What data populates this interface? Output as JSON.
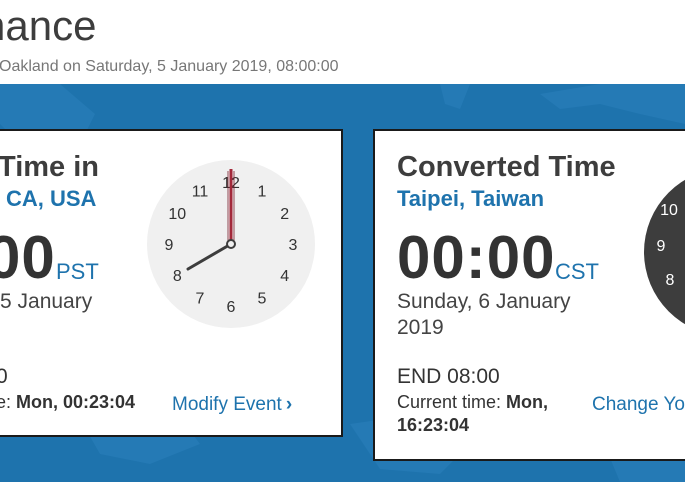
{
  "header": {
    "title": "nance",
    "subtitle": "Oakland on Saturday, 5 January 2019, 08:00:00"
  },
  "left_card": {
    "title": "Time in",
    "location": "CA, USA",
    "time": "00",
    "timezone": "PST",
    "date": "5 January",
    "end": "0",
    "current_label": "e:",
    "current_value": "Mon, 00:23:04",
    "action": "Modify Event",
    "clock": {
      "hour": 8,
      "minute": 0,
      "face": "light"
    }
  },
  "right_card": {
    "title": "Converted Time",
    "location": "Taipei, Taiwan",
    "time": "00:00",
    "timezone": "CST",
    "date_line1": "Sunday, 6 January",
    "date_line2": "2019",
    "end": "END 08:00",
    "current_label": "Current time:",
    "current_value_line1": "Mon,",
    "current_value_line2": "16:23:04",
    "action": "Change Yo",
    "clock": {
      "face": "dark",
      "numbers": [
        "10",
        "9",
        "8"
      ]
    }
  },
  "clock_numbers": [
    "12",
    "1",
    "2",
    "3",
    "4",
    "5",
    "6",
    "7",
    "8",
    "9",
    "10",
    "11"
  ],
  "colors": {
    "band": "#1e73ad",
    "accent": "#1e73ad",
    "minute_hand": "#a3283a",
    "hour_hand": "#3d3d3d",
    "dark_clock_face": "#3d3d3d"
  },
  "icons": {
    "chevron": "chevron-right-icon"
  }
}
